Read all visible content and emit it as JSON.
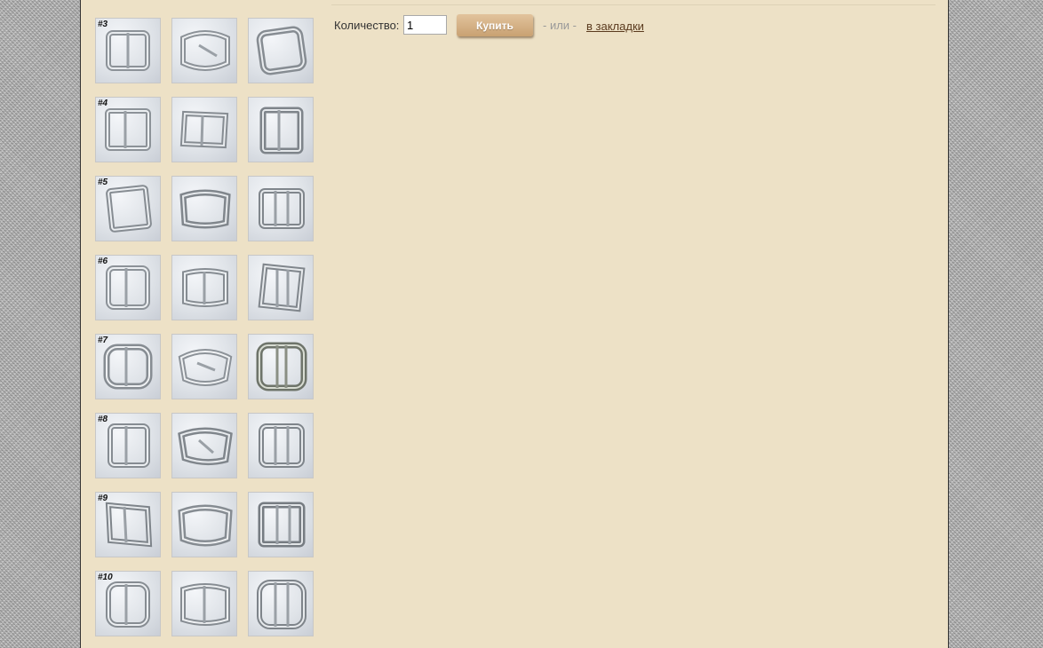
{
  "gallery": {
    "rows": [
      {
        "tag": "#3"
      },
      {
        "tag": "#4"
      },
      {
        "tag": "#5"
      },
      {
        "tag": "#6"
      },
      {
        "tag": "#7"
      },
      {
        "tag": "#8"
      },
      {
        "tag": "#9"
      },
      {
        "tag": "#10"
      }
    ]
  },
  "purchase": {
    "quantity_label": "Количество:",
    "quantity_value": "1",
    "buy_label": "Купить",
    "or_text": "- или -",
    "bookmark_label": "в закладки"
  }
}
